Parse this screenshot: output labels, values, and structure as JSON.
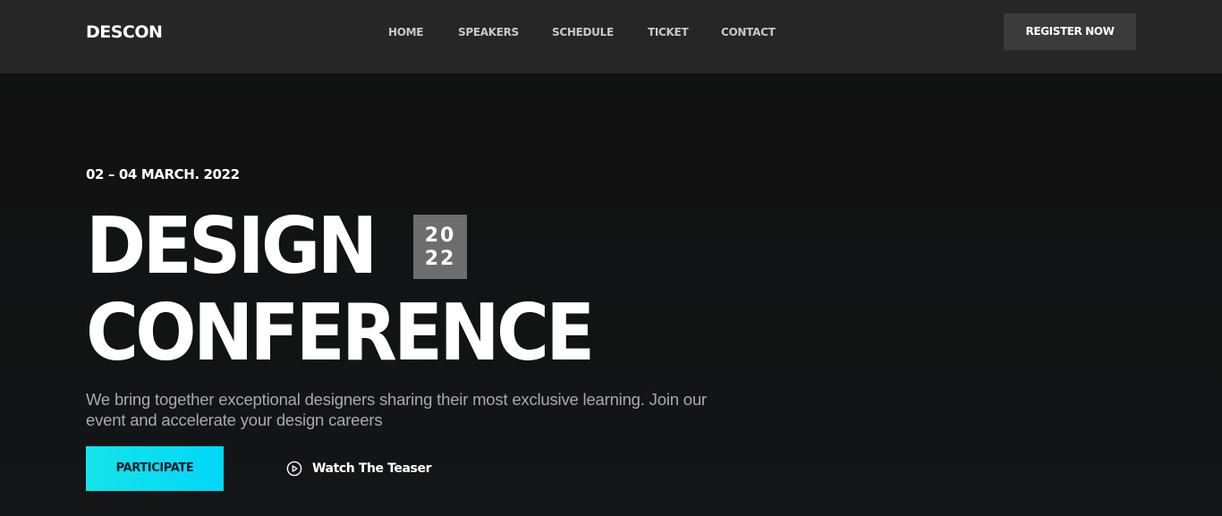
{
  "header": {
    "logo": "DESCON",
    "nav": [
      "HOME",
      "SPEAKERS",
      "SCHEDULE",
      "TICKET",
      "CONTACT"
    ],
    "register_label": "REGISTER NOW"
  },
  "hero": {
    "date": "02 – 04 MARCH. 2022",
    "title_line_1": "DESIGN",
    "title_line_2": "CONFERENCE",
    "year_top": "20",
    "year_bottom": "22",
    "description": "We bring together exceptional designers sharing their most exclusive learning. Join our event and accelerate your design careers",
    "participate_label": "PARTICIPATE",
    "teaser_label": "Watch The Teaser",
    "teaser_icon": "play-circle-icon"
  },
  "colors": {
    "header_bg": "#262626",
    "page_bg": "#121314",
    "register_bg": "#3b3b3c",
    "year_badge_bg": "#6d6d6d",
    "accent_cyan": "#14e3e9",
    "text_muted": "#a9a9a9"
  }
}
